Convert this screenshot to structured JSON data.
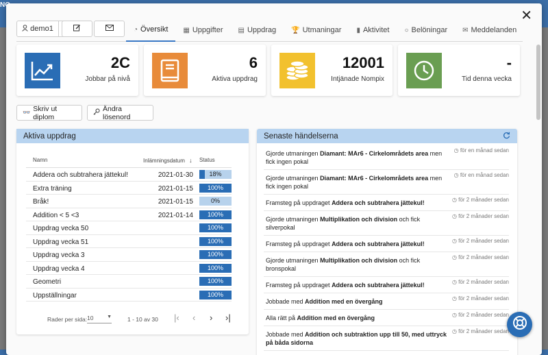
{
  "background": {
    "logo": "NO"
  },
  "header": {
    "user_label": "demo1",
    "tabs": [
      {
        "label": "Översikt",
        "icon": "gauge-icon",
        "active": true
      },
      {
        "label": "Uppgifter",
        "icon": "table-icon"
      },
      {
        "label": "Uppdrag",
        "icon": "document-icon"
      },
      {
        "label": "Utmaningar",
        "icon": "trophy-icon"
      },
      {
        "label": "Aktivitet",
        "icon": "bar-chart-icon"
      },
      {
        "label": "Belöningar",
        "icon": "circle-icon"
      },
      {
        "label": "Meddelanden",
        "icon": "envelope-icon"
      }
    ]
  },
  "stats": [
    {
      "value": "2C",
      "label": "Jobbar på nivå",
      "color": "#2a6db5",
      "icon": "trend-chart-icon"
    },
    {
      "value": "6",
      "label": "Aktiva uppdrag",
      "color": "#e88b3a",
      "icon": "book-icon"
    },
    {
      "value": "12001",
      "label": "Intjänade Nompix",
      "color": "#f2c12e",
      "icon": "coins-icon"
    },
    {
      "value": "-",
      "label": "Tid denna vecka",
      "color": "#6a9e52",
      "icon": "clock-icon"
    }
  ],
  "actions": {
    "print_label": "Skriv ut diplom",
    "password_label": "Ändra lösenord"
  },
  "missions": {
    "title": "Aktiva uppdrag",
    "columns": {
      "name": "Namn",
      "date": "Inlämningsdatum",
      "status": "Status"
    },
    "rows": [
      {
        "name": "Addera och subtrahera jättekul!",
        "date": "2021-01-30",
        "progress": 18,
        "status": "18%"
      },
      {
        "name": "Extra träning",
        "date": "2021-01-15",
        "progress": 100,
        "status": "100%"
      },
      {
        "name": "Bråk!",
        "date": "2021-01-15",
        "progress": 0,
        "status": "0%"
      },
      {
        "name": "Addition < 5 <3",
        "date": "2021-01-14",
        "progress": 100,
        "status": "100%"
      },
      {
        "name": "Uppdrag vecka 50",
        "date": "",
        "progress": 100,
        "status": "100%"
      },
      {
        "name": "Uppdrag vecka 51",
        "date": "",
        "progress": 100,
        "status": "100%"
      },
      {
        "name": "Uppdrag vecka 3",
        "date": "",
        "progress": 100,
        "status": "100%"
      },
      {
        "name": "Uppdrag vecka 4",
        "date": "",
        "progress": 100,
        "status": "100%"
      },
      {
        "name": "Geometri",
        "date": "",
        "progress": 100,
        "status": "100%"
      },
      {
        "name": "Uppställningar",
        "date": "",
        "progress": 100,
        "status": "100%"
      }
    ],
    "pagination": {
      "rows_per_page_label": "Rader per sida:",
      "rows_per_page": "10",
      "range": "1 - 10 av 30"
    }
  },
  "events": {
    "title": "Senaste händelserna",
    "items": [
      {
        "pre": "Gjorde utmaningen ",
        "bold": "Diamant: MAr6 - Cirkelområdets area",
        "post": " men fick ingen pokal",
        "time": "för en månad sedan"
      },
      {
        "pre": "Gjorde utmaningen ",
        "bold": "Diamant: MAr6 - Cirkelområdets area",
        "post": " men fick ingen pokal",
        "time": "för en månad sedan"
      },
      {
        "pre": "Framsteg på uppdraget ",
        "bold": "Addera och subtrahera jättekul!",
        "post": "",
        "time": "för 2 månader sedan"
      },
      {
        "pre": "Gjorde utmaningen ",
        "bold": "Multiplikation och division",
        "post": " och fick silverpokal",
        "time": "för 2 månader sedan"
      },
      {
        "pre": "Framsteg på uppdraget ",
        "bold": "Addera och subtrahera jättekul!",
        "post": "",
        "time": "för 2 månader sedan"
      },
      {
        "pre": "Gjorde utmaningen ",
        "bold": "Multiplikation och division",
        "post": " och fick bronspokal",
        "time": "för 2 månader sedan"
      },
      {
        "pre": "Framsteg på uppdraget ",
        "bold": "Addera och subtrahera jättekul!",
        "post": "",
        "time": "för 2 månader sedan"
      },
      {
        "pre": "Jobbade med ",
        "bold": "Addition med en övergång",
        "post": "",
        "time": "för 2 månader sedan"
      },
      {
        "pre": "Alla rätt på ",
        "bold": "Addition med en övergång",
        "post": "",
        "time": "för 2 månader sedan"
      },
      {
        "pre": "Jobbade med ",
        "bold": "Addition och subtraktion upp till 50, med uttryck på båda sidorna",
        "post": "",
        "time": "för 2 månader sedan"
      }
    ]
  },
  "colors": {
    "accent": "#2a6db5",
    "panel_head": "#b8d4f0"
  }
}
